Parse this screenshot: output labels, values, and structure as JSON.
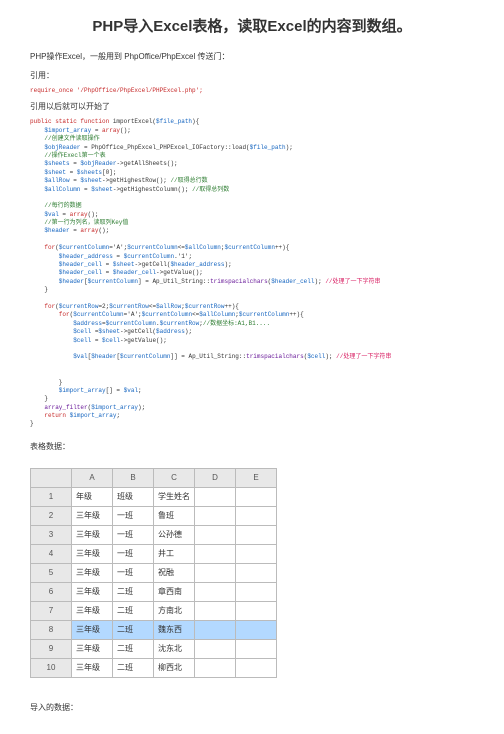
{
  "title": "PHP导入Excel表格，读取Excel的内容到数组。",
  "intro": "PHP操作Excel，一般用到 PhpOffice/PhpExcel 传送门：",
  "label_include": "引用：",
  "require_line_kw": "require_once",
  "require_line_str": " '/PhpOffice/PhpExcel/PHPExcel.php';",
  "after_include": "引用以后就可以开始了",
  "code": {
    "l1_a": "public static function",
    "l1_b": " importExcel(",
    "l1_c": "$file_path",
    "l1_d": "){",
    "l2_a": "    $import_array",
    "l2_b": " = ",
    "l2_c": "array",
    "l2_d": "();",
    "l3": "    //创建文件读取操作",
    "l4_a": "    $objReader",
    "l4_b": " = PhpOffice_PhpExcel_PHPExcel_IOFactory::load(",
    "l4_c": "$file_path",
    "l4_d": ");",
    "l5": "    //操作Execl第一个表",
    "l6_a": "    $sheets",
    "l6_b": " = ",
    "l6_c": "$objReader",
    "l6_d": "->getAllSheets();",
    "l7_a": "    $sheet",
    "l7_b": " = ",
    "l7_c": "$sheets",
    "l7_d": "[0];",
    "l8_a": "    $allRow",
    "l8_b": " = ",
    "l8_c": "$sheet",
    "l8_d": "->getHighestRow(); ",
    "l8_e": "//取得总行数",
    "l9_a": "    $allColumn",
    "l9_b": " = ",
    "l9_c": "$sheet",
    "l9_d": "->getHighestColumn(); ",
    "l9_e": "//取得总列数",
    "blank1": "",
    "l10": "    //每行的数据",
    "l11_a": "    $val",
    "l11_b": " = ",
    "l11_c": "array",
    "l11_d": "();",
    "l12": "    //第一行为列名，读取列Key值",
    "l13_a": "    $header",
    "l13_b": " = ",
    "l13_c": "array",
    "l13_d": "();",
    "blank2": "",
    "l14_a": "    for",
    "l14_b": "(",
    "l14_c": "$currentColumn",
    "l14_d": "='A';",
    "l14_e": "$currentColumn",
    "l14_f": "<=",
    "l14_g": "$allColumn",
    "l14_h": ";",
    "l14_i": "$currentColumn",
    "l14_j": "++){",
    "l15_a": "        $header_address",
    "l15_b": " = ",
    "l15_c": "$currentColumn",
    "l15_d": ".'1';",
    "l16_a": "        $header_cell",
    "l16_b": " = ",
    "l16_c": "$sheet",
    "l16_d": "->getCell(",
    "l16_e": "$header_address",
    "l16_f": ");",
    "l17_a": "        $header_cell",
    "l17_b": " = ",
    "l17_c": "$header_cell",
    "l17_d": "->getValue();",
    "l18_a": "        $header",
    "l18_b": "[",
    "l18_c": "$currentColumn",
    "l18_d": "] = Ap_Util_String::",
    "l18_e": "trimspacialchars",
    "l18_f": "(",
    "l18_g": "$header_cell",
    "l18_h": "); ",
    "l18_i": "//处理了一下字符串",
    "l19": "    }",
    "blank3": "",
    "l20_a": "    for",
    "l20_b": "(",
    "l20_c": "$currentRow",
    "l20_d": "=2;",
    "l20_e": "$currentRow",
    "l20_f": "<=",
    "l20_g": "$allRow",
    "l20_h": ";",
    "l20_i": "$currentRow",
    "l20_j": "++){",
    "l21_a": "        for",
    "l21_b": "(",
    "l21_c": "$currentColumn",
    "l21_d": "='A';",
    "l21_e": "$currentColumn",
    "l21_f": "<=",
    "l21_g": "$allColumn",
    "l21_h": ";",
    "l21_i": "$currentColumn",
    "l21_j": "++){",
    "l22_a": "            $address",
    "l22_b": "=",
    "l22_c": "$currentColumn",
    "l22_d": ".",
    "l22_e": "$currentRow",
    "l22_f": ";",
    "l22_g": "//数据坐标:A1,B1....",
    "l23_a": "            $cell",
    "l23_b": " =",
    "l23_c": "$sheet",
    "l23_d": "->getCell(",
    "l23_e": "$address",
    "l23_f": ");",
    "l24_a": "            $cell",
    "l24_b": " = ",
    "l24_c": "$cell",
    "l24_d": "->getValue();",
    "blank4": "",
    "l25_a": "            $val",
    "l25_b": "[",
    "l25_c": "$header",
    "l25_d": "[",
    "l25_e": "$currentColumn",
    "l25_f": "]] = Ap_Util_String::",
    "l25_g": "trimspacialchars",
    "l25_h": "(",
    "l25_i": "$cell",
    "l25_j": "); ",
    "l25_k": "//处理了一下字符串",
    "blank5": "",
    "blank6": "",
    "l26": "        }",
    "l27_a": "        $import_array",
    "l27_b": "[] = ",
    "l27_c": "$val",
    "l27_d": ";",
    "l28": "    }",
    "l29_a": "    array_filter",
    "l29_b": "(",
    "l29_c": "$import_array",
    "l29_d": ");",
    "l30_a": "    return",
    "l30_b": " ",
    "l30_c": "$import_array",
    "l30_d": ";",
    "l31": "}"
  },
  "section_table": "表格数据：",
  "table": {
    "cols": [
      "",
      "A",
      "B",
      "C",
      "D",
      "E"
    ],
    "rows": [
      [
        "1",
        "年级",
        "班级",
        "学生姓名",
        "",
        ""
      ],
      [
        "2",
        "三年级",
        "一班",
        "鲁班",
        "",
        ""
      ],
      [
        "3",
        "三年级",
        "一班",
        "公孙德",
        "",
        ""
      ],
      [
        "4",
        "三年级",
        "一班",
        "井工",
        "",
        ""
      ],
      [
        "5",
        "三年级",
        "一班",
        "祝融",
        "",
        ""
      ],
      [
        "6",
        "三年级",
        "二班",
        "章西南",
        "",
        ""
      ],
      [
        "7",
        "三年级",
        "二班",
        "方南北",
        "",
        ""
      ],
      [
        "8",
        "三年级",
        "二班",
        "魏东西",
        "",
        ""
      ],
      [
        "9",
        "三年级",
        "二班",
        "沈东北",
        "",
        ""
      ],
      [
        "10",
        "三年级",
        "二班",
        "柳西北",
        "",
        ""
      ]
    ],
    "highlight_row": 7
  },
  "section_import": "导入的数据："
}
